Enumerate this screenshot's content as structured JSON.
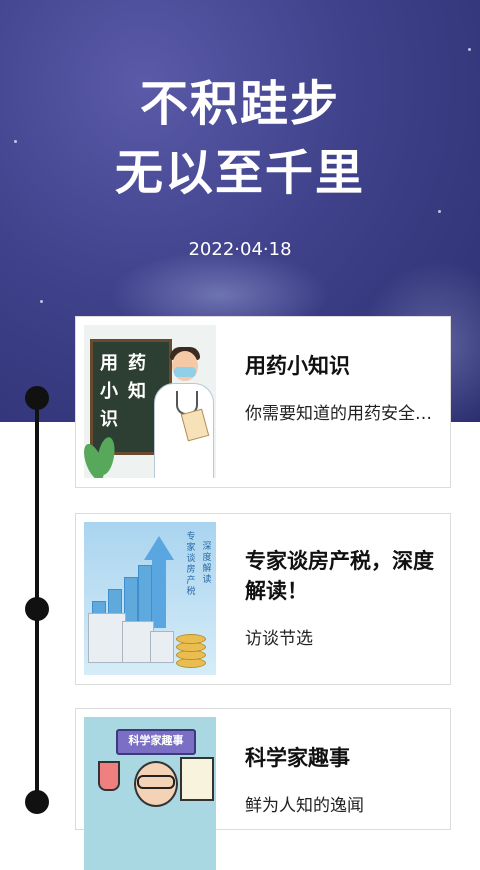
{
  "header": {
    "title_line1": "不积跬步",
    "title_line2": "无以至千里",
    "date": "2022·04·18"
  },
  "cards": [
    {
      "title": "用药小知识",
      "subtitle": "你需要知道的用药安全常识",
      "thumb_chars": [
        "用",
        "药",
        "小",
        "知",
        "识"
      ]
    },
    {
      "title": "专家谈房产税，深度解读！",
      "subtitle": "访谈节选",
      "thumb_text_1": "专家谈房产税",
      "thumb_text_2": "深度解读"
    },
    {
      "title": "科学家趣事",
      "subtitle": "鲜为人知的逸闻",
      "thumb_banner": "科学家趣事"
    }
  ],
  "colors": {
    "header_bg": "#3f418a",
    "timeline": "#111111",
    "card_border": "#dcdcdc"
  }
}
